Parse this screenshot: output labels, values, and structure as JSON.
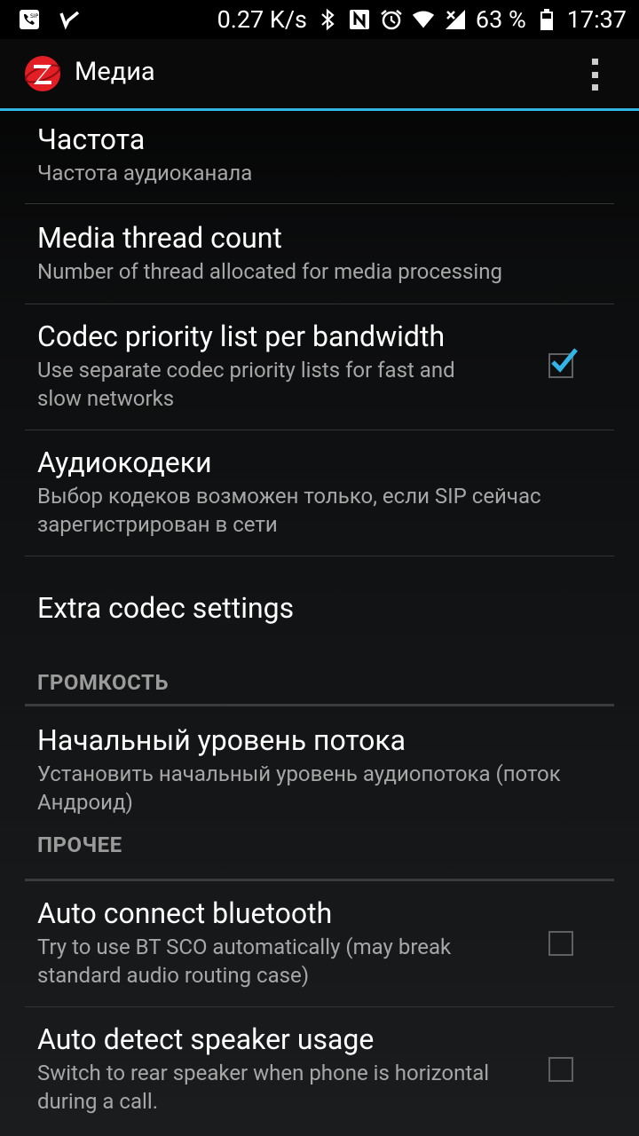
{
  "status_bar": {
    "net_speed": "0.27 K/s",
    "battery_percent": "63 %",
    "time": "17:37",
    "icons": [
      "sip-phone-icon",
      "check-icon",
      "bluetooth-icon",
      "nfc-icon",
      "alarm-icon",
      "wifi-icon",
      "signal-icon",
      "battery-icon"
    ]
  },
  "app_bar": {
    "title": "Медиа",
    "logo_icon": "zoiper-logo-icon",
    "menu_icon": "overflow-menu-icon"
  },
  "preferences": [
    {
      "title": "Частота",
      "summary": "Частота аудиоканала"
    },
    {
      "title": "Media thread count",
      "summary": "Number of thread allocated for media processing"
    },
    {
      "title": "Codec priority list per bandwidth",
      "summary": "Use separate codec priority lists for fast and slow networks",
      "checked": true
    },
    {
      "title": "Аудиокодеки",
      "summary": "Выбор кодеков возможен только, если SIP сейчас зарегистрирован в сети"
    },
    {
      "title": "Extra codec settings"
    }
  ],
  "categories": {
    "volume": {
      "label": "ГРОМКОСТЬ",
      "items": [
        {
          "title": "Начальный уровень потока",
          "summary": "Установить начальный уровень аудиопотока (поток Андроид)"
        }
      ]
    },
    "other": {
      "label": "ПРОЧЕЕ",
      "items": [
        {
          "title": "Auto connect bluetooth",
          "summary": "Try to use BT SCO automatically (may break standard audio routing case)",
          "checked": false
        },
        {
          "title": "Auto detect speaker usage",
          "summary": "Switch to rear speaker when phone is horizontal during a call.",
          "checked": false
        }
      ]
    }
  },
  "colors": {
    "accent": "#33b5e5",
    "checkmark": "#33b5e5",
    "logo_red": "#e31e24"
  }
}
